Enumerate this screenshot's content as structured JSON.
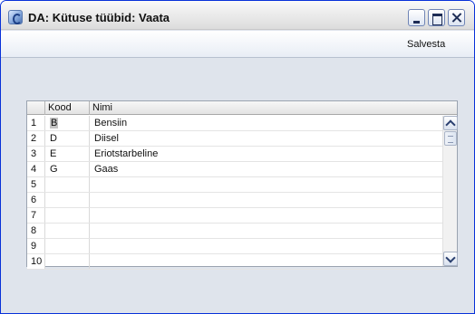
{
  "window": {
    "title": "DA: Kütuse tüübid: Vaata"
  },
  "toolbar": {
    "save_label": "Salvesta"
  },
  "table": {
    "columns": [
      "",
      "Kood",
      "Nimi"
    ],
    "rows": [
      {
        "num": "1",
        "kood": "B",
        "nimi": "Bensiin"
      },
      {
        "num": "2",
        "kood": "D",
        "nimi": "Diisel"
      },
      {
        "num": "3",
        "kood": "E",
        "nimi": "Eriotstarbeline"
      },
      {
        "num": "4",
        "kood": "G",
        "nimi": "Gaas"
      },
      {
        "num": "5",
        "kood": "",
        "nimi": ""
      },
      {
        "num": "6",
        "kood": "",
        "nimi": ""
      },
      {
        "num": "7",
        "kood": "",
        "nimi": ""
      },
      {
        "num": "8",
        "kood": "",
        "nimi": ""
      },
      {
        "num": "9",
        "kood": "",
        "nimi": ""
      },
      {
        "num": "10",
        "kood": "",
        "nimi": ""
      }
    ]
  },
  "icons": {
    "app": "app-icon",
    "minimize": "minimize-icon",
    "maximize": "maximize-icon",
    "close": "close-icon",
    "scroll_up": "chevron-up-icon",
    "scroll_down": "chevron-down-icon"
  }
}
